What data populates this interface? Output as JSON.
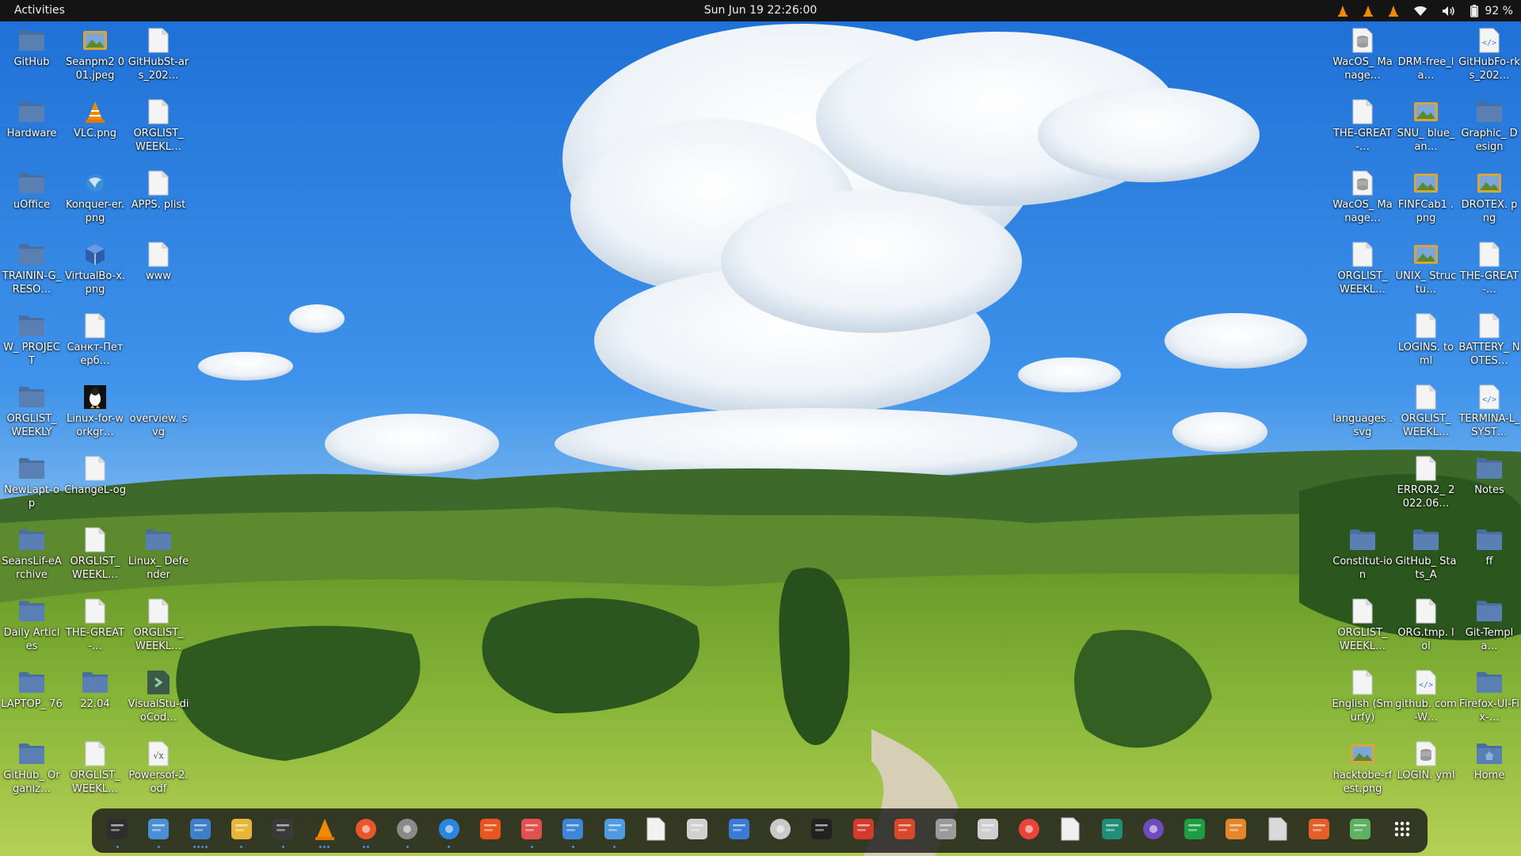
{
  "topbar": {
    "activities": "Activities",
    "clock": "Sun Jun 19  22:26:00",
    "battery_percent": "92 %"
  },
  "desktop_left": [
    {
      "label": "GitHub",
      "icon": "folder-icon"
    },
    {
      "label": "Seanpm2 001.jpeg",
      "icon": "image-file-icon"
    },
    {
      "label": "GitHubSt-ars_202…",
      "icon": "text-file-icon"
    },
    {
      "label": "Hardware",
      "icon": "folder-icon"
    },
    {
      "label": "VLC.png",
      "icon": "vlc-icon"
    },
    {
      "label": "ORGLIST_ WEEKL…",
      "icon": "text-file-icon"
    },
    {
      "label": "uOffice",
      "icon": "folder-icon"
    },
    {
      "label": "Konquer-er.png",
      "icon": "konqueror-icon"
    },
    {
      "label": "APPS. plist",
      "icon": "text-file-icon"
    },
    {
      "label": "TRAININ-G_RESO…",
      "icon": "folder-icon"
    },
    {
      "label": "VirtualBo-x.png",
      "icon": "virtualbox-icon"
    },
    {
      "label": "www",
      "icon": "text-file-icon"
    },
    {
      "label": "W_ PROJECT",
      "icon": "folder-icon"
    },
    {
      "label": "Санкт-Петерб…",
      "icon": "text-file-icon"
    },
    {
      "label": "",
      "icon": ""
    },
    {
      "label": "ORGLIST_ WEEKLY",
      "icon": "folder-icon"
    },
    {
      "label": "Linux-for-workgr…",
      "icon": "tux-icon"
    },
    {
      "label": "overview. svg",
      "icon": ""
    },
    {
      "label": "NewLapt-op",
      "icon": "folder-icon"
    },
    {
      "label": "ChangeL-og",
      "icon": "text-file-icon"
    },
    {
      "label": "",
      "icon": ""
    },
    {
      "label": "SeansLif-eArchive",
      "icon": "folder-icon"
    },
    {
      "label": "ORGLIST_ WEEKL…",
      "icon": "text-file-icon"
    },
    {
      "label": "Linux_ Defender",
      "icon": "folder-icon"
    },
    {
      "label": "Daily Articles",
      "icon": "folder-icon"
    },
    {
      "label": "THE-GREAT-…",
      "icon": "text-file-icon"
    },
    {
      "label": "ORGLIST_ WEEKL…",
      "icon": "text-file-icon"
    },
    {
      "label": "LAPTOP_ 76",
      "icon": "folder-icon"
    },
    {
      "label": "22.04",
      "icon": "folder-icon"
    },
    {
      "label": "VisualStu-dioCod…",
      "icon": "vscode-icon"
    },
    {
      "label": "GitHub_ Organiz…",
      "icon": "folder-icon"
    },
    {
      "label": "ORGLIST_ WEEKL…",
      "icon": "text-file-icon"
    },
    {
      "label": "Powersof-2.odf",
      "icon": "formula-file-icon"
    }
  ],
  "desktop_right": [
    {
      "label": "WacOS_ Manage…",
      "icon": "database-file-icon"
    },
    {
      "label": "DRM-free_la…",
      "icon": ""
    },
    {
      "label": "GitHubFo-rks_202…",
      "icon": "code-file-icon"
    },
    {
      "label": "THE-GREAT-…",
      "icon": "text-file-icon"
    },
    {
      "label": "SNU_ blue_an…",
      "icon": "image-file-icon"
    },
    {
      "label": "Graphic_ Design",
      "icon": "folder-icon"
    },
    {
      "label": "WacOS_ Manage…",
      "icon": "database-file-icon"
    },
    {
      "label": "FINFCab1 .png",
      "icon": "image-file-icon"
    },
    {
      "label": "DROTEX. png",
      "icon": "image-file-icon"
    },
    {
      "label": "ORGLIST_ WEEKL…",
      "icon": "text-file-icon"
    },
    {
      "label": "UNIX_ Structu…",
      "icon": "image-file-icon"
    },
    {
      "label": "THE-GREAT-…",
      "icon": "text-file-icon"
    },
    {
      "label": "",
      "icon": ""
    },
    {
      "label": "LOGINS. toml",
      "icon": "text-file-icon"
    },
    {
      "label": "BATTERY_ NOTES…",
      "icon": "text-file-icon"
    },
    {
      "label": "languages .svg",
      "icon": ""
    },
    {
      "label": "ORGLIST_ WEEKL…",
      "icon": "text-file-icon"
    },
    {
      "label": "TERMINA-L_SYST…",
      "icon": "code-file-icon"
    },
    {
      "label": "",
      "icon": ""
    },
    {
      "label": "ERROR2_ 2022.06…",
      "icon": "text-file-icon"
    },
    {
      "label": "Notes",
      "icon": "folder-icon"
    },
    {
      "label": "Constitut-ion",
      "icon": "folder-icon"
    },
    {
      "label": "GitHub_ Stats_A",
      "icon": "folder-icon"
    },
    {
      "label": "ff",
      "icon": "folder-icon"
    },
    {
      "label": "ORGLIST_ WEEKL…",
      "icon": "text-file-icon"
    },
    {
      "label": "ORG.tmp. lol",
      "icon": "text-file-icon"
    },
    {
      "label": "Git-Templa…",
      "icon": "folder-icon"
    },
    {
      "label": "English (Smurfy)",
      "icon": "text-file-icon"
    },
    {
      "label": "github. com-W…",
      "icon": "code-file-icon"
    },
    {
      "label": "Firefox-UI-Fix-…",
      "icon": "folder-icon"
    },
    {
      "label": "hacktobe-rfest.png",
      "icon": "image-file-icon"
    },
    {
      "label": "LOGIN. yml",
      "icon": "database-file-icon"
    },
    {
      "label": "Home",
      "icon": "home-folder-icon"
    }
  ],
  "dock": [
    {
      "name": "system-monitor",
      "color": "#2e2e2e",
      "running": 1
    },
    {
      "name": "files",
      "color": "#4a8fd3",
      "running": 1
    },
    {
      "name": "text-editor",
      "color": "#3d7fc9",
      "running": 4
    },
    {
      "name": "calculator",
      "color": "#e7b53a",
      "running": 1
    },
    {
      "name": "terminal",
      "color": "#3a3a3a",
      "running": 1
    },
    {
      "name": "vlc",
      "color": "#f08a00",
      "running": 3
    },
    {
      "name": "firefox",
      "color": "#e8562b",
      "running": 2
    },
    {
      "name": "settings",
      "color": "#8a8a8a",
      "running": 1
    },
    {
      "name": "help",
      "color": "#2a86e0",
      "running": 1
    },
    {
      "name": "software",
      "color": "#e95420",
      "running": 0
    },
    {
      "name": "performance",
      "color": "#e35050",
      "running": 1
    },
    {
      "name": "editor",
      "color": "#3e86d6",
      "running": 1
    },
    {
      "name": "tweaks",
      "color": "#4e9be0",
      "running": 1
    },
    {
      "name": "document",
      "color": "#f2f2f2",
      "running": 0
    },
    {
      "name": "screenshot",
      "color": "#d0d0d0",
      "running": 0
    },
    {
      "name": "virtualbox",
      "color": "#3a7bd5",
      "running": 0
    },
    {
      "name": "camera",
      "color": "#c9c9c9",
      "running": 0
    },
    {
      "name": "inkscape",
      "color": "#222222",
      "running": 0
    },
    {
      "name": "boat",
      "color": "#d33a2c",
      "running": 0
    },
    {
      "name": "game",
      "color": "#d9482b",
      "running": 0
    },
    {
      "name": "archive",
      "color": "#9a9a9a",
      "running": 0
    },
    {
      "name": "search",
      "color": "#cfcfcf",
      "running": 0
    },
    {
      "name": "chrome",
      "color": "#e9433a",
      "running": 0
    },
    {
      "name": "books",
      "color": "#f0f0f0",
      "running": 0
    },
    {
      "name": "gitkraken",
      "color": "#1f8f7a",
      "running": 0
    },
    {
      "name": "screen-recorder",
      "color": "#6e4bbf",
      "running": 0
    },
    {
      "name": "calc",
      "color": "#1e9e44",
      "running": 0
    },
    {
      "name": "impress",
      "color": "#e5862a",
      "running": 0
    },
    {
      "name": "math",
      "color": "#d9d9d9",
      "running": 0
    },
    {
      "name": "draw",
      "color": "#e65f2b",
      "running": 0
    },
    {
      "name": "trash",
      "color": "#5fb05f",
      "running": 0
    },
    {
      "name": "app-grid",
      "color": "#ffffff",
      "running": 0
    }
  ],
  "colors": {
    "topbar_bg": "#141414",
    "folder": "#4a6fa0",
    "accent": "#e95420",
    "dock_running_dot": "#4a90d9"
  }
}
